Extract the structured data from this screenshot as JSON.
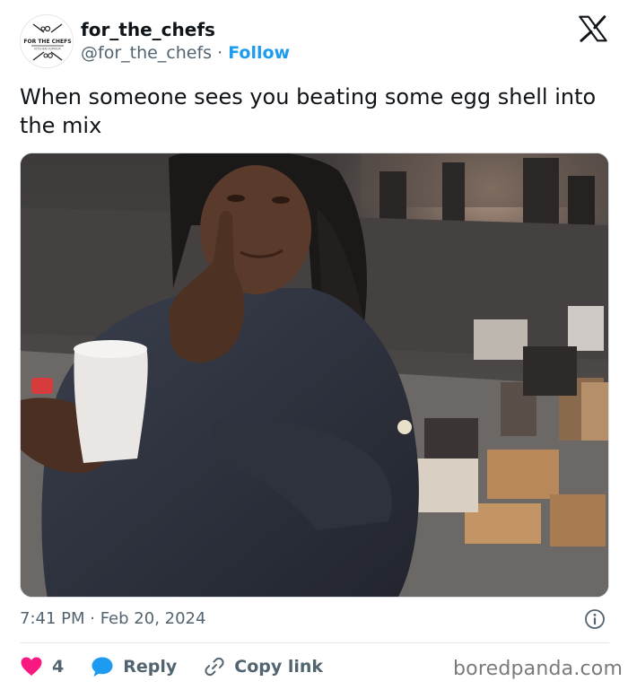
{
  "account": {
    "display_name": "for_the_chefs",
    "handle": "@for_the_chefs",
    "separator": "·",
    "follow_label": "Follow",
    "avatar_text": "FOR THE CHEFS",
    "avatar_subtext": "KITCHEN HUMOUR"
  },
  "tweet": {
    "text": "When someone sees you beating some egg shell into the mix",
    "timestamp": "7:41 PM · Feb 20, 2024"
  },
  "actions": {
    "like_count": "4",
    "reply_label": "Reply",
    "copy_link_label": "Copy link"
  },
  "watermark": "boredpanda.com",
  "icons": {
    "platform": "x-logo-icon",
    "info": "info-icon",
    "like": "heart-icon",
    "reply": "speech-bubble-icon",
    "copy_link": "link-icon"
  },
  "colors": {
    "follow": "#1d9bf0",
    "heart": "#f91880",
    "reply_bubble": "#1d9bf0",
    "secondary_text": "#536471"
  }
}
